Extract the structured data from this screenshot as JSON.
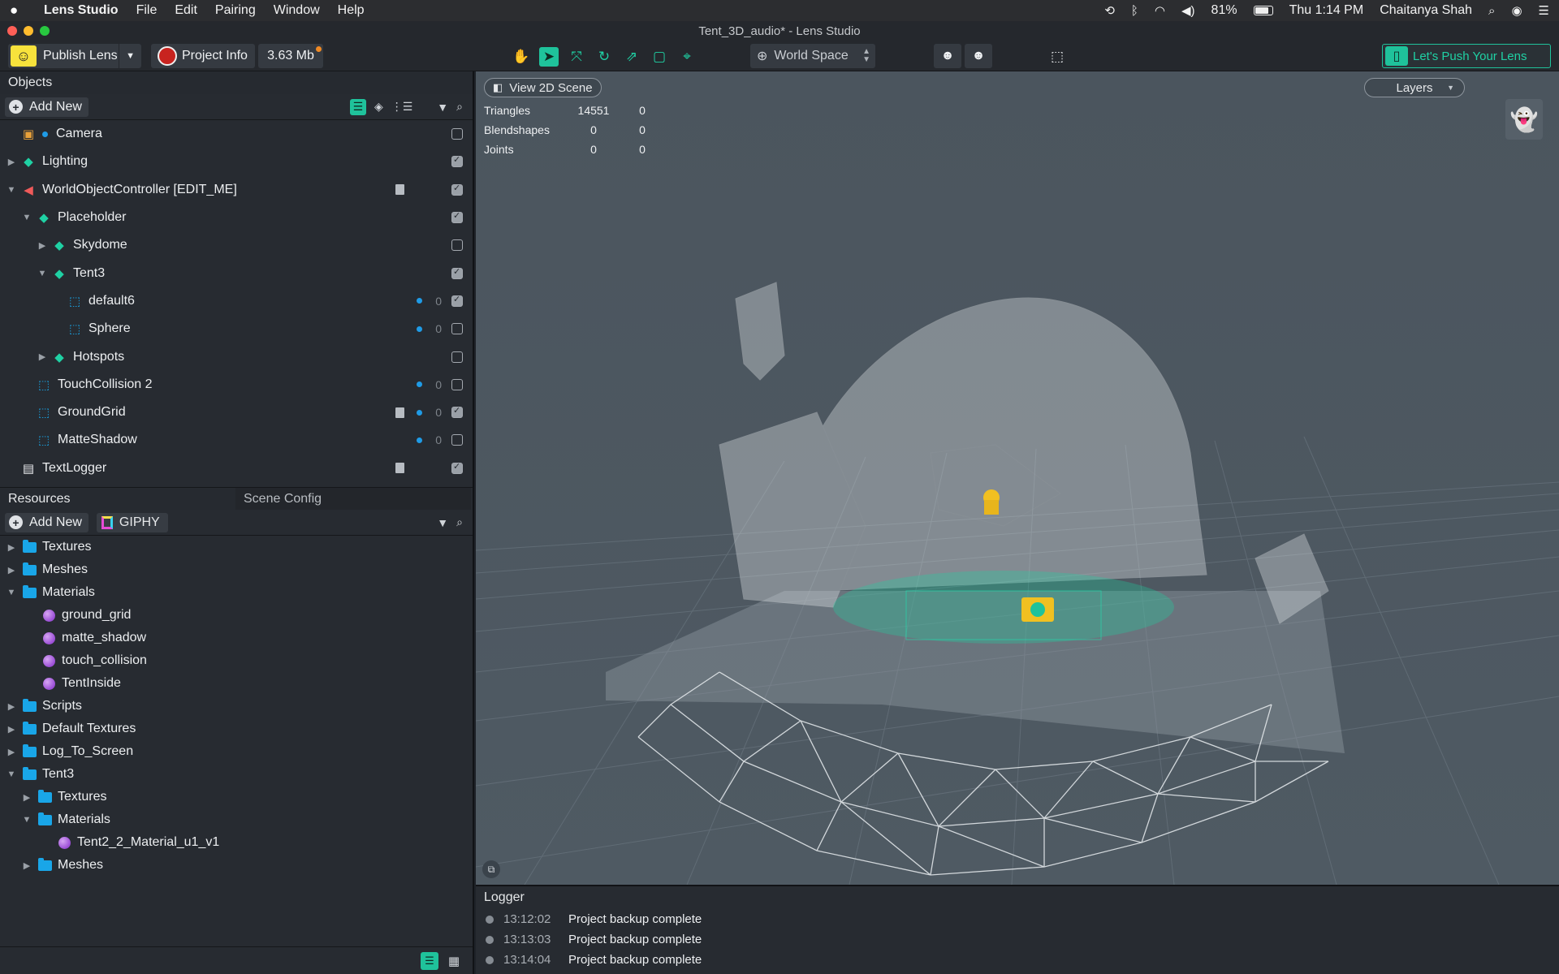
{
  "menubar": {
    "app": "Lens Studio",
    "items": [
      "File",
      "Edit",
      "Pairing",
      "Window",
      "Help"
    ],
    "battery": "81%",
    "clock": "Thu 1:14 PM",
    "user": "Chaitanya Shah"
  },
  "window_title": "Tent_3D_audio* - Lens Studio",
  "toolbar": {
    "publish_label": "Publish Lens",
    "project_info_label": "Project Info",
    "size": "3.63 Mb",
    "space_label": "World Space",
    "push_label": "Let's Push Your Lens"
  },
  "objects": {
    "title": "Objects",
    "add_new": "Add New",
    "rows": [
      {
        "label": "Camera",
        "depth": 0,
        "arrow": "",
        "icon": "camera-icon",
        "checked": false,
        "dot": false,
        "count": "",
        "doc": false
      },
      {
        "label": "Lighting",
        "depth": 0,
        "arrow": "▶",
        "icon": "light-icon",
        "checked": true,
        "dot": false,
        "count": "",
        "doc": false
      },
      {
        "label": "WorldObjectController [EDIT_ME]",
        "depth": 0,
        "arrow": "▼",
        "icon": "audio-icon",
        "checked": true,
        "dot": false,
        "count": "",
        "doc": true
      },
      {
        "label": "Placeholder",
        "depth": 1,
        "arrow": "▼",
        "icon": "group-icon",
        "checked": true,
        "dot": false,
        "count": "",
        "doc": false
      },
      {
        "label": "Skydome",
        "depth": 2,
        "arrow": "▶",
        "icon": "group-icon",
        "checked": false,
        "dot": false,
        "count": "",
        "doc": false
      },
      {
        "label": "Tent3",
        "depth": 2,
        "arrow": "▼",
        "icon": "group-icon",
        "checked": true,
        "dot": false,
        "count": "",
        "doc": false
      },
      {
        "label": "default6",
        "depth": 3,
        "arrow": "",
        "icon": "mesh-icon",
        "checked": true,
        "dot": true,
        "count": "0",
        "doc": false
      },
      {
        "label": "Sphere",
        "depth": 3,
        "arrow": "",
        "icon": "mesh-icon",
        "checked": false,
        "dot": true,
        "count": "0",
        "doc": false
      },
      {
        "label": "Hotspots",
        "depth": 2,
        "arrow": "▶",
        "icon": "group-icon",
        "checked": false,
        "dot": false,
        "count": "",
        "doc": false
      },
      {
        "label": "TouchCollision 2",
        "depth": 1,
        "arrow": "",
        "icon": "mesh-icon",
        "checked": false,
        "dot": true,
        "count": "0",
        "doc": false
      },
      {
        "label": "GroundGrid",
        "depth": 1,
        "arrow": "",
        "icon": "mesh-icon",
        "checked": true,
        "dot": true,
        "count": "0",
        "doc": true
      },
      {
        "label": "MatteShadow",
        "depth": 1,
        "arrow": "",
        "icon": "mesh-icon",
        "checked": false,
        "dot": true,
        "count": "0",
        "doc": false
      },
      {
        "label": "TextLogger",
        "depth": 0,
        "arrow": "",
        "icon": "script-icon",
        "checked": true,
        "dot": false,
        "count": "",
        "doc": true
      }
    ]
  },
  "resources": {
    "tab_resources": "Resources",
    "tab_scene_config": "Scene Config",
    "add_new": "Add New",
    "giphy": "GIPHY",
    "rows": [
      {
        "label": "Textures",
        "depth": 0,
        "arrow": "▶",
        "type": "folder"
      },
      {
        "label": "Meshes",
        "depth": 0,
        "arrow": "▶",
        "type": "folder"
      },
      {
        "label": "Materials",
        "depth": 0,
        "arrow": "▼",
        "type": "folder"
      },
      {
        "label": "ground_grid",
        "depth": 1,
        "arrow": "",
        "type": "material"
      },
      {
        "label": "matte_shadow",
        "depth": 1,
        "arrow": "",
        "type": "material"
      },
      {
        "label": "touch_collision",
        "depth": 1,
        "arrow": "",
        "type": "material"
      },
      {
        "label": "TentInside",
        "depth": 1,
        "arrow": "",
        "type": "material"
      },
      {
        "label": "Scripts",
        "depth": 0,
        "arrow": "▶",
        "type": "folder"
      },
      {
        "label": "Default Textures",
        "depth": 0,
        "arrow": "▶",
        "type": "folder"
      },
      {
        "label": "Log_To_Screen",
        "depth": 0,
        "arrow": "▶",
        "type": "folder"
      },
      {
        "label": "Tent3",
        "depth": 0,
        "arrow": "▼",
        "type": "folder"
      },
      {
        "label": "Textures",
        "depth": 1,
        "arrow": "▶",
        "type": "folder"
      },
      {
        "label": "Materials",
        "depth": 1,
        "arrow": "▼",
        "type": "folder"
      },
      {
        "label": "Tent2_2_Material_u1_v1",
        "depth": 2,
        "arrow": "",
        "type": "material"
      },
      {
        "label": "Meshes",
        "depth": 1,
        "arrow": "▶",
        "type": "folder"
      }
    ]
  },
  "viewport": {
    "view2d_label": "View 2D Scene",
    "layers_label": "Layers",
    "stats": [
      {
        "label": "Triangles",
        "v1": "14551",
        "v2": "0"
      },
      {
        "label": "Blendshapes",
        "v1": "0",
        "v2": "0"
      },
      {
        "label": "Joints",
        "v1": "0",
        "v2": "0"
      }
    ]
  },
  "logger": {
    "title": "Logger",
    "entries": [
      {
        "time": "13:12:02",
        "msg": "Project backup complete"
      },
      {
        "time": "13:13:03",
        "msg": "Project backup complete"
      },
      {
        "time": "13:14:04",
        "msg": "Project backup complete"
      }
    ]
  },
  "colors": {
    "accent": "#1fc29b",
    "panel": "#272b31",
    "viewport": "#4b555e",
    "folder": "#19a6e8"
  }
}
